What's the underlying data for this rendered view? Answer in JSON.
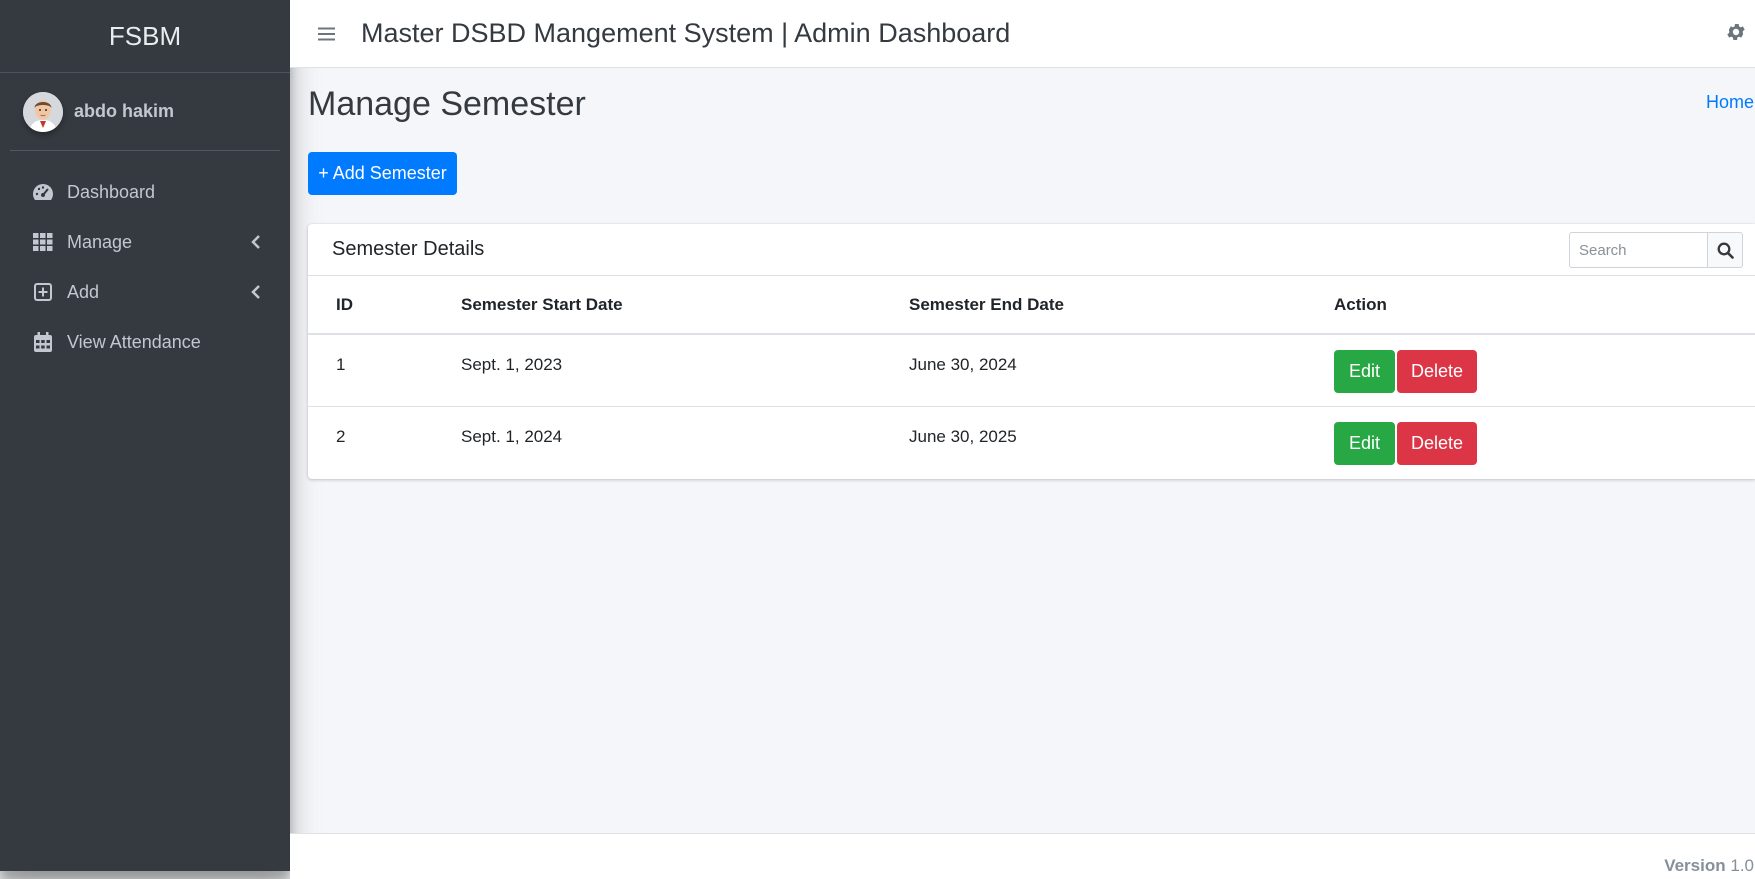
{
  "sidebar": {
    "brand": "FSBM",
    "user_name": "abdo hakim",
    "avatar_icon": "user-avatar",
    "items": [
      {
        "label": "Dashboard",
        "icon": "tachometer-icon",
        "chevron": false
      },
      {
        "label": "Manage",
        "icon": "grid-icon",
        "chevron": true
      },
      {
        "label": "Add",
        "icon": "plus-square-icon",
        "chevron": true
      },
      {
        "label": "View Attendance",
        "icon": "calendar-icon",
        "chevron": false
      }
    ]
  },
  "navbar": {
    "title": "Master DSBD Mangement System | Admin Dashboard",
    "menu_icon": "hamburger-icon",
    "settings_icon": "gear-icon"
  },
  "page": {
    "title": "Manage Semester",
    "breadcrumb": "Home",
    "add_button": "+ Add Semester"
  },
  "card": {
    "title": "Semester Details",
    "search_placeholder": "Search",
    "columns": [
      "ID",
      "Semester Start Date",
      "Semester End Date",
      "Action"
    ],
    "rows": [
      {
        "id": "1",
        "start": "Sept. 1, 2023",
        "end": "June 30, 2024",
        "edit": "Edit",
        "delete": "Delete"
      },
      {
        "id": "2",
        "start": "Sept. 1, 2024",
        "end": "June 30, 2025",
        "edit": "Edit",
        "delete": "Delete"
      }
    ]
  },
  "footer": {
    "version_label": "Version",
    "version_number": "1.0"
  },
  "colors": {
    "sidebar_bg": "#343a40",
    "primary": "#007bff",
    "success": "#28a745",
    "danger": "#dc3545"
  }
}
